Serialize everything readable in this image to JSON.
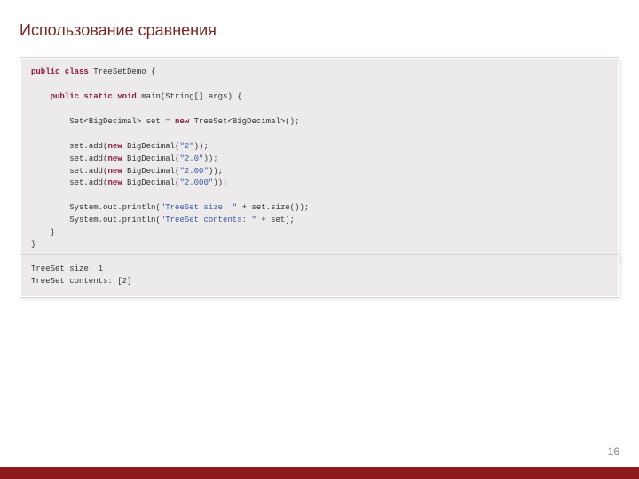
{
  "title": "Использование сравнения",
  "code": {
    "kw_public": "public",
    "kw_class": "class",
    "cls_name": " TreeSetDemo {",
    "kw_public2": "public",
    "kw_static": "static",
    "kw_void": "void",
    "main_sig": " main(String[] args) {",
    "line_set_decl_a": "Set<BigDecimal> set = ",
    "kw_new": "new",
    "line_set_decl_b": " TreeSet<BigDecimal>();",
    "add1_a": "set.add(",
    "add1_b": " BigDecimal(",
    "add1_str": "\"2\"",
    "add1_c": "));",
    "add2_a": "set.add(",
    "add2_b": " BigDecimal(",
    "add2_str": "\"2.0\"",
    "add2_c": "));",
    "add3_a": "set.add(",
    "add3_b": " BigDecimal(",
    "add3_str": "\"2.00\"",
    "add3_c": "));",
    "add4_a": "set.add(",
    "add4_b": " BigDecimal(",
    "add4_str": "\"2.000\"",
    "add4_c": "));",
    "print1_a": "System.out.println(",
    "print1_str": "\"TreeSet size: \"",
    "print1_b": " + set.size());",
    "print2_a": "System.out.println(",
    "print2_str": "\"TreeSet contents: \"",
    "print2_b": " + set);",
    "close_inner": "    }",
    "close_outer": "}"
  },
  "output": {
    "line1": "TreeSet size: 1",
    "line2": "TreeSet contents: [2]"
  },
  "page_number": "16"
}
